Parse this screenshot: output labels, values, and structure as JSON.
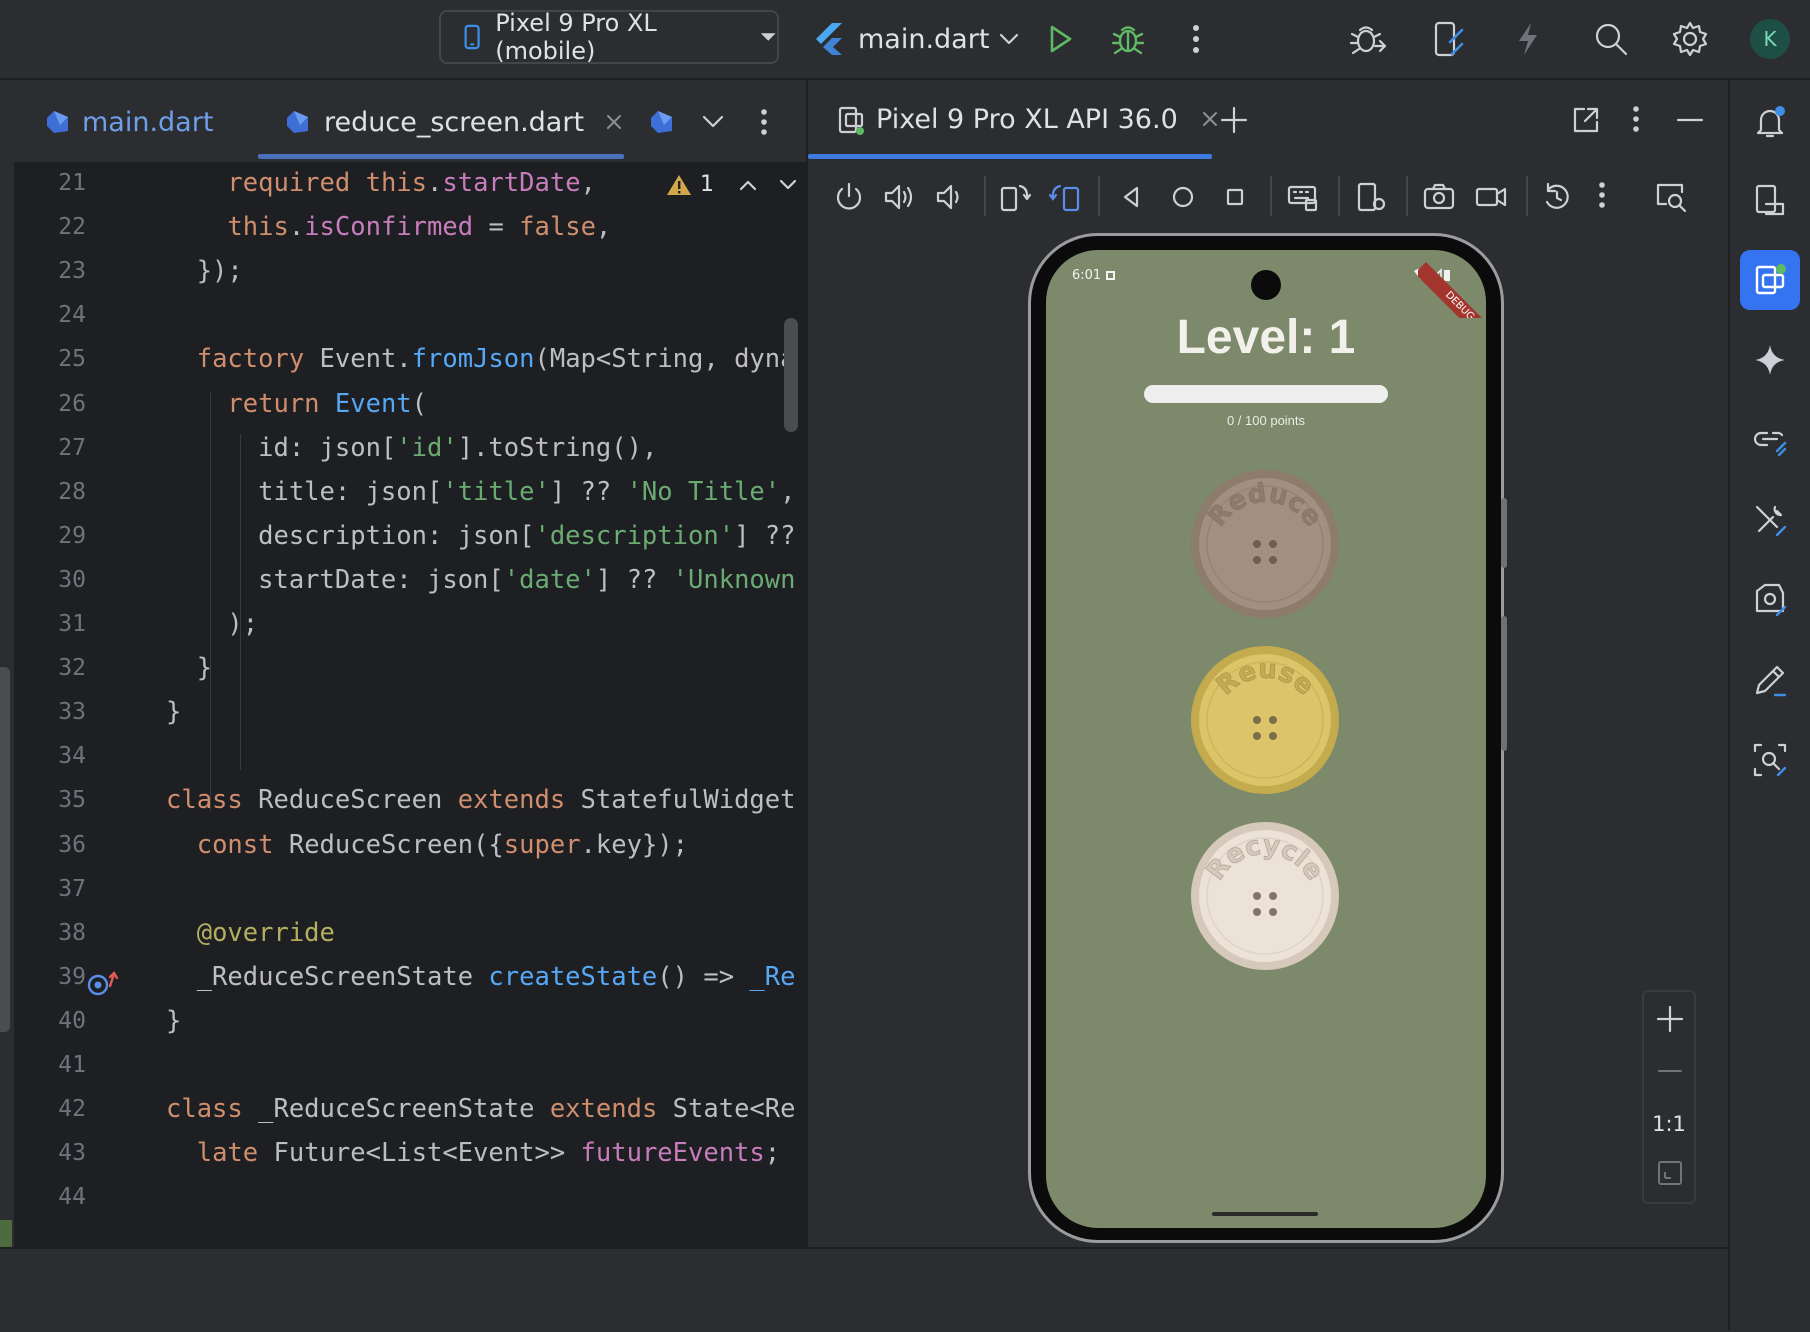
{
  "toolbar": {
    "device_label": "Pixel 9 Pro XL (mobile)",
    "run_config": "main.dart",
    "profile_initial": "K",
    "colors": {
      "run": "#5fb865",
      "debug": "#5fb865",
      "avatar_bg": "#1e4f45",
      "avatar_text": "#7cd6b9"
    }
  },
  "editor": {
    "tabs": [
      {
        "label": "main.dart",
        "active": false
      },
      {
        "label": "reduce_screen.dart",
        "active": true
      }
    ],
    "inspection": {
      "warnings": "1"
    },
    "lines": [
      {
        "n": "21",
        "tokens": [
          [
            "    ",
            ""
          ],
          [
            "required ",
            "kw"
          ],
          [
            "this",
            "kw"
          ],
          [
            ".",
            ""
          ],
          [
            "startDate",
            "fld"
          ],
          [
            ",",
            ""
          ]
        ]
      },
      {
        "n": "22",
        "tokens": [
          [
            "    ",
            ""
          ],
          [
            "this",
            "kw"
          ],
          [
            ".",
            ""
          ],
          [
            "isConfirmed",
            "fld"
          ],
          [
            " = ",
            ""
          ],
          [
            "false",
            "kw"
          ],
          [
            ",",
            ""
          ]
        ]
      },
      {
        "n": "23",
        "tokens": [
          [
            "  });",
            ""
          ]
        ]
      },
      {
        "n": "24",
        "tokens": []
      },
      {
        "n": "25",
        "tokens": [
          [
            "  ",
            ""
          ],
          [
            "factory ",
            "kw"
          ],
          [
            "Event.",
            ""
          ],
          [
            "fromJson",
            "fn"
          ],
          [
            "(Map<String, dyna",
            ""
          ]
        ]
      },
      {
        "n": "26",
        "tokens": [
          [
            "    ",
            ""
          ],
          [
            "return ",
            "kw"
          ],
          [
            "Event",
            "fn"
          ],
          [
            "(",
            ""
          ]
        ]
      },
      {
        "n": "27",
        "tokens": [
          [
            "      id: json[",
            ""
          ],
          [
            "'id'",
            "str"
          ],
          [
            "].toString(),",
            ""
          ]
        ]
      },
      {
        "n": "28",
        "tokens": [
          [
            "      title: json[",
            ""
          ],
          [
            "'title'",
            "str"
          ],
          [
            "] ?? ",
            ""
          ],
          [
            "'No Title'",
            "str"
          ],
          [
            ",",
            ""
          ]
        ]
      },
      {
        "n": "29",
        "tokens": [
          [
            "      description: json[",
            ""
          ],
          [
            "'description'",
            "str"
          ],
          [
            "] ??",
            ""
          ]
        ]
      },
      {
        "n": "30",
        "tokens": [
          [
            "      startDate: json[",
            ""
          ],
          [
            "'date'",
            "str"
          ],
          [
            "] ?? ",
            ""
          ],
          [
            "'Unknown",
            "str"
          ]
        ]
      },
      {
        "n": "31",
        "tokens": [
          [
            "    );",
            ""
          ]
        ]
      },
      {
        "n": "32",
        "tokens": [
          [
            "  }",
            ""
          ]
        ]
      },
      {
        "n": "33",
        "tokens": [
          [
            "}",
            ""
          ]
        ]
      },
      {
        "n": "34",
        "tokens": []
      },
      {
        "n": "35",
        "tokens": [
          [
            "class ",
            "kw"
          ],
          [
            "ReduceScreen ",
            ""
          ],
          [
            "extends ",
            "kw"
          ],
          [
            "StatefulWidget",
            ""
          ]
        ]
      },
      {
        "n": "36",
        "tokens": [
          [
            "  ",
            ""
          ],
          [
            "const ",
            "kw"
          ],
          [
            "ReduceScreen({",
            ""
          ],
          [
            "super",
            "kw"
          ],
          [
            ".key});",
            ""
          ]
        ]
      },
      {
        "n": "37",
        "tokens": []
      },
      {
        "n": "38",
        "tokens": [
          [
            "  ",
            ""
          ],
          [
            "@override",
            "ann"
          ]
        ]
      },
      {
        "n": "39",
        "tokens": [
          [
            "  _ReduceScreenState ",
            ""
          ],
          [
            "createState",
            "fn"
          ],
          [
            "() => ",
            ""
          ],
          [
            "_Re",
            "fn"
          ]
        ]
      },
      {
        "n": "40",
        "tokens": [
          [
            "}",
            ""
          ]
        ]
      },
      {
        "n": "41",
        "tokens": []
      },
      {
        "n": "42",
        "tokens": [
          [
            "class ",
            "kw"
          ],
          [
            "_ReduceScreenState ",
            ""
          ],
          [
            "extends ",
            "kw"
          ],
          [
            "State<Re",
            ""
          ]
        ]
      },
      {
        "n": "43",
        "tokens": [
          [
            "  ",
            ""
          ],
          [
            "late ",
            "kw"
          ],
          [
            "Future<List<Event>> ",
            ""
          ],
          [
            "futureEvents",
            "fld"
          ],
          [
            ";",
            ""
          ]
        ]
      },
      {
        "n": "44",
        "tokens": []
      }
    ]
  },
  "emulator": {
    "tab_label": "Pixel 9 Pro XL API 36.0",
    "zoom_label": "1:1",
    "device": {
      "time": "6:01",
      "debug_banner": "DEBUG",
      "level_title": "Level: 1",
      "progress_value": 0.0,
      "points_text": "0 / 100 points",
      "buttons": [
        {
          "label": "Reduce",
          "color": "#a18f7f",
          "rim": "#8d7b6c"
        },
        {
          "label": "Reuse",
          "color": "#dcc46a",
          "rim": "#c4ab4d"
        },
        {
          "label": "Recycle",
          "color": "#ece2d8",
          "rim": "#d6c9bb"
        }
      ],
      "background": "#7c896a"
    }
  }
}
